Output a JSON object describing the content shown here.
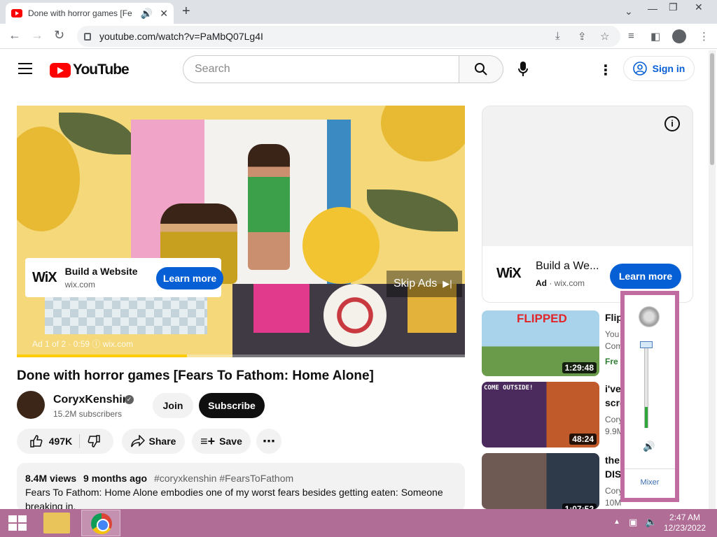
{
  "browser": {
    "tab_title": "Done with horror games [Fe",
    "url": "youtube.com/watch?v=PaMbQ07Lg4I"
  },
  "header": {
    "logo_text": "YouTube",
    "search_placeholder": "Search",
    "signin_label": "Sign in"
  },
  "player": {
    "ad_title": "Build a Website",
    "ad_domain": "wix.com",
    "ad_logo": "WiX",
    "learn_more": "Learn more",
    "skip_label": "Skip Ads",
    "ad_info": "Ad 1 of 2 · 0:59 ⓘ  wix.com",
    "progress": 0.38
  },
  "video": {
    "title": "Done with horror games [Fears To Fathom: Home Alone]",
    "channel": "CoryxKenshin",
    "subscribers": "15.2M subscribers",
    "join_label": "Join",
    "subscribe_label": "Subscribe",
    "likes": "497K",
    "share_label": "Share",
    "save_label": "Save",
    "views": "8.4M views",
    "age": "9 months ago",
    "hashtags": "#coryxkenshin #FearsToFathom",
    "description_line1": "Fears To Fathom: Home Alone embodies one of my worst fears besides getting eaten: Someone",
    "description_line2": "breaking in."
  },
  "side_ad": {
    "logo": "WiX",
    "title": "Build a We...",
    "ad_label": "Ad",
    "domain": "wix.com",
    "learn_more": "Learn more"
  },
  "recommendations": [
    {
      "title": "Flip",
      "meta1": "You",
      "meta2": "Com",
      "badge": "Fre",
      "duration": "1:29:48",
      "thumb_text": "FLIPPED"
    },
    {
      "title": "i've",
      "meta1": "scre",
      "meta2": "Cory",
      "meta3": "9.9M",
      "duration": "48:24",
      "thumb_text": "COME OUTSIDE!"
    },
    {
      "title": "the",
      "meta1": "DIS",
      "meta2": "Cory",
      "meta3": "10M views",
      "duration": "1:07:52"
    }
  ],
  "volume": {
    "level": 0.25,
    "mixer_label": "Mixer"
  },
  "taskbar": {
    "time": "2:47 AM",
    "date": "12/23/2022"
  }
}
